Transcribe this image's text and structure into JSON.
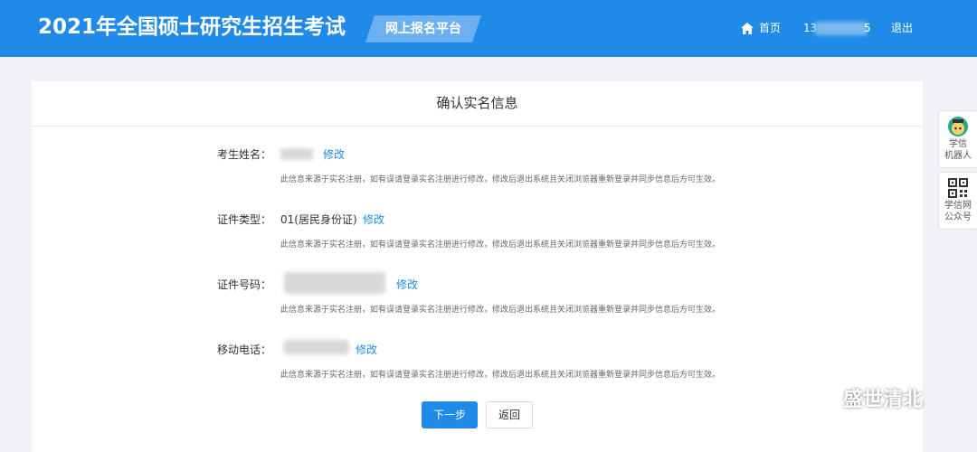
{
  "header": {
    "site_title": "2021年全国硕士研究生招生考试",
    "platform_tag": "网上报名平台",
    "home_label": "首页",
    "phone_prefix": "13",
    "phone_suffix": "5",
    "logout_label": "退出"
  },
  "card": {
    "title": "确认实名信息",
    "note": "此信息来源于实名注册，如有误请登录实名注册进行修改，修改后退出系统且关闭浏览器重新登录并同步信息后方可生效。",
    "fields": [
      {
        "label": "考生姓名：",
        "value": "",
        "edit": "修改"
      },
      {
        "label": "证件类型：",
        "value": "01(居民身份证)",
        "edit": "修改"
      },
      {
        "label": "证件号码：",
        "value": "",
        "edit": "修改"
      },
      {
        "label": "移动电话：",
        "value": "",
        "edit": "修改"
      }
    ],
    "next_button": "下一步",
    "back_button": "返回"
  },
  "side": {
    "robot_line1": "学信",
    "robot_line2": "机器人",
    "wechat_line1": "学信网",
    "wechat_line2": "公众号"
  },
  "watermark": "盛世清北",
  "colors": {
    "primary": "#1f8ae8",
    "header_bg": "#1f8ae8",
    "page_bg": "#f0f2f5"
  },
  "icons": [
    "home-icon",
    "robot-icon",
    "qr-code-icon",
    "wechat-icon"
  ]
}
